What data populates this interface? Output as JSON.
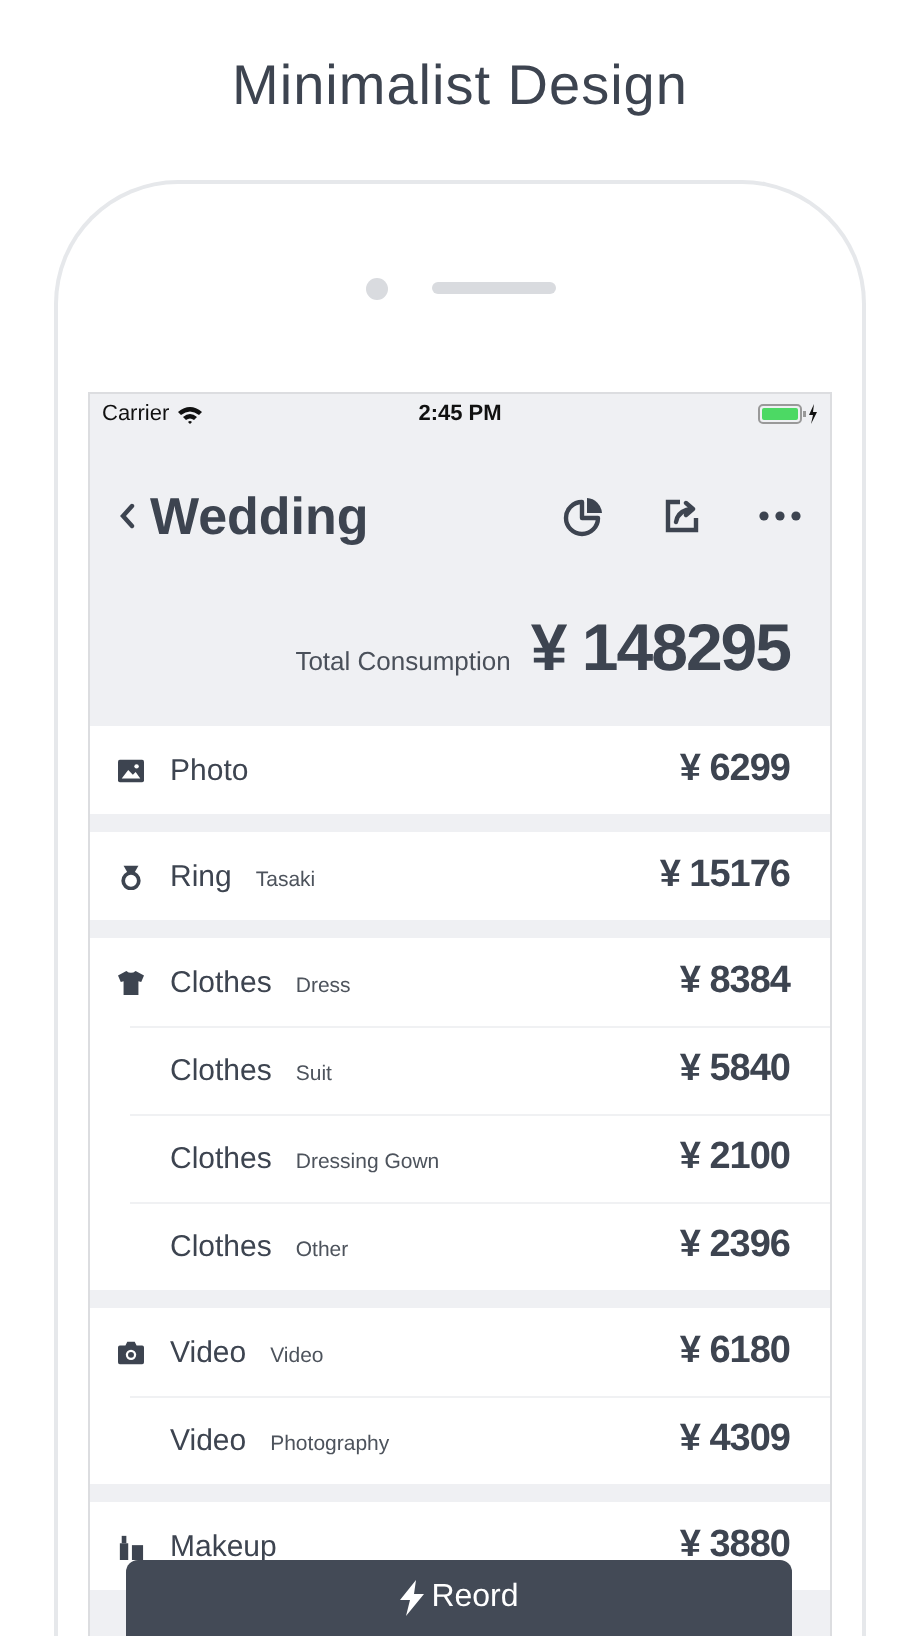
{
  "headline": "Minimalist Design",
  "status_bar": {
    "carrier": "Carrier",
    "time": "2:45 PM"
  },
  "nav": {
    "title": "Wedding"
  },
  "total": {
    "label": "Total Consumption",
    "amount": "¥ 148295"
  },
  "groups": [
    {
      "kind": "photo",
      "rows": [
        {
          "name": "Photo",
          "amount": "¥ 6299"
        }
      ]
    },
    {
      "kind": "ring",
      "rows": [
        {
          "name": "Ring",
          "note": "Tasaki",
          "amount": "¥ 15176"
        }
      ]
    },
    {
      "kind": "clothes",
      "rows": [
        {
          "name": "Clothes",
          "note": "Dress",
          "amount": "¥ 8384"
        },
        {
          "name": "Clothes",
          "note": "Suit",
          "amount": "¥ 5840"
        },
        {
          "name": "Clothes",
          "note": "Dressing Gown",
          "amount": "¥ 2100"
        },
        {
          "name": "Clothes",
          "note": "Other",
          "amount": "¥ 2396"
        }
      ]
    },
    {
      "kind": "video",
      "rows": [
        {
          "name": "Video",
          "note": "Video",
          "amount": "¥ 6180"
        },
        {
          "name": "Video",
          "note": "Photography",
          "amount": "¥ 4309"
        }
      ]
    },
    {
      "kind": "makeup",
      "rows": [
        {
          "name": "Makeup",
          "amount": "¥ 3880"
        }
      ]
    }
  ],
  "action_button": {
    "label": "Reord"
  }
}
